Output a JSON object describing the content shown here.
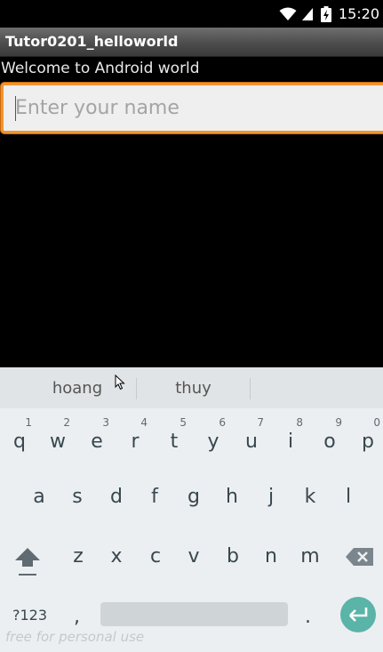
{
  "status_bar": {
    "time": "15:20",
    "icons": [
      "wifi-icon",
      "cell-signal-icon",
      "battery-charging-icon"
    ]
  },
  "app": {
    "title": "Tutor0201_helloworld"
  },
  "content": {
    "welcome_text": "Welcome to Android world",
    "name_input": {
      "placeholder": "Enter your name",
      "value": ""
    }
  },
  "keyboard": {
    "suggestions": [
      "hoang",
      "thuy",
      ""
    ],
    "row1": [
      {
        "key": "q",
        "hint": "1"
      },
      {
        "key": "w",
        "hint": "2"
      },
      {
        "key": "e",
        "hint": "3"
      },
      {
        "key": "r",
        "hint": "4"
      },
      {
        "key": "t",
        "hint": "5"
      },
      {
        "key": "y",
        "hint": "6"
      },
      {
        "key": "u",
        "hint": "7"
      },
      {
        "key": "i",
        "hint": "8"
      },
      {
        "key": "o",
        "hint": "9"
      },
      {
        "key": "p",
        "hint": "0"
      }
    ],
    "row2": [
      "a",
      "s",
      "d",
      "f",
      "g",
      "h",
      "j",
      "k",
      "l"
    ],
    "row3": [
      "z",
      "x",
      "c",
      "v",
      "b",
      "n",
      "m"
    ],
    "symbols_label": "?123",
    "comma": ",",
    "period": "."
  },
  "watermark": "free for personal use",
  "colors": {
    "input_focus_border": "#f0942d",
    "enter_key": "#5ab4a8",
    "keyboard_bg": "#eceff1"
  }
}
